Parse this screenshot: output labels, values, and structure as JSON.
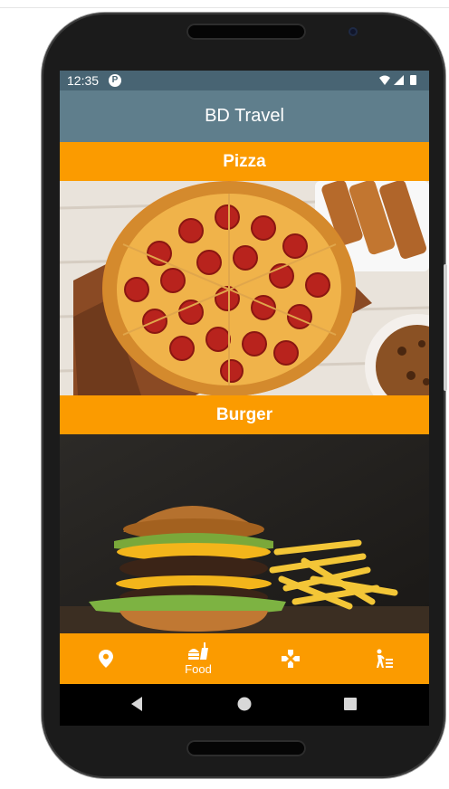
{
  "status_bar": {
    "time": "12:35"
  },
  "app_bar": {
    "title": "BD Travel"
  },
  "foods": [
    {
      "title": "Pizza",
      "image_icon": "pizza-photo"
    },
    {
      "title": "Burger",
      "image_icon": "burger-photo"
    }
  ],
  "bottom_nav": {
    "items": [
      {
        "icon": "location-pin-icon",
        "label": ""
      },
      {
        "icon": "fastfood-icon",
        "label": "Food"
      },
      {
        "icon": "gamepad-icon",
        "label": ""
      },
      {
        "icon": "hiking-icon",
        "label": ""
      }
    ],
    "selected": "Food"
  },
  "colors": {
    "status_bar": "#486473",
    "app_bar": "#5f7e8c",
    "accent_orange": "#fb9b00"
  }
}
